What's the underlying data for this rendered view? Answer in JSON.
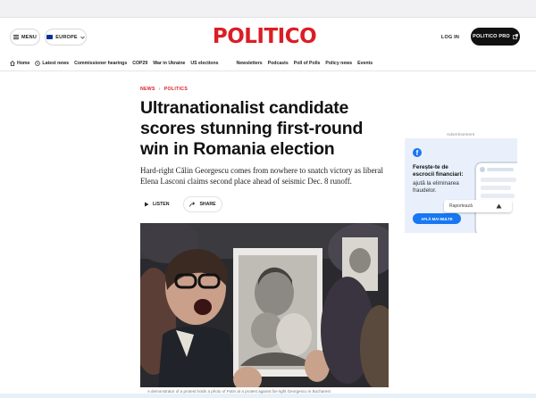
{
  "header": {
    "menu_label": "MENU",
    "edition_label": "EUROPE",
    "logo_text": "POLITICO",
    "login_label": "LOG IN",
    "pro_label": "POLITICO PRO"
  },
  "nav": {
    "items": [
      {
        "label": "Home",
        "icon": "home-icon"
      },
      {
        "label": "Latest news",
        "icon": "clock-icon"
      },
      {
        "label": "Commissioner hearings"
      },
      {
        "label": "COP29"
      },
      {
        "label": "War in Ukraine"
      },
      {
        "label": "US elections"
      },
      {
        "label": "Newsletters"
      },
      {
        "label": "Podcasts"
      },
      {
        "label": "Poll of Polls"
      },
      {
        "label": "Policy news"
      },
      {
        "label": "Events"
      }
    ]
  },
  "article": {
    "kicker_primary": "NEWS",
    "kicker_secondary": "POLITICS",
    "headline": "Ultranationalist candidate scores stunning first-round win in Romania election",
    "standfirst": "Hard-right Călin Georgescu comes from nowhere to snatch victory as liberal Elena Lasconi claims second place ahead of seismic Dec. 8 runoff.",
    "listen_label": "LISTEN",
    "share_label": "SHARE",
    "caption": "A demonstrator of a protest holds a photo of Putin at a protest against far-right Georgescu in Bucharest"
  },
  "ad": {
    "label": "Advertisement",
    "title": "Ferește-te de escrocii financiari:",
    "body": "ajută la eliminarea fraudelor.",
    "cta": "AFLĂ MAI MULTE",
    "report_label": "Raportează"
  },
  "colors": {
    "brand_red": "#dc1d24",
    "facebook_blue": "#1877f2",
    "ad_background": "#e9f0fb"
  }
}
